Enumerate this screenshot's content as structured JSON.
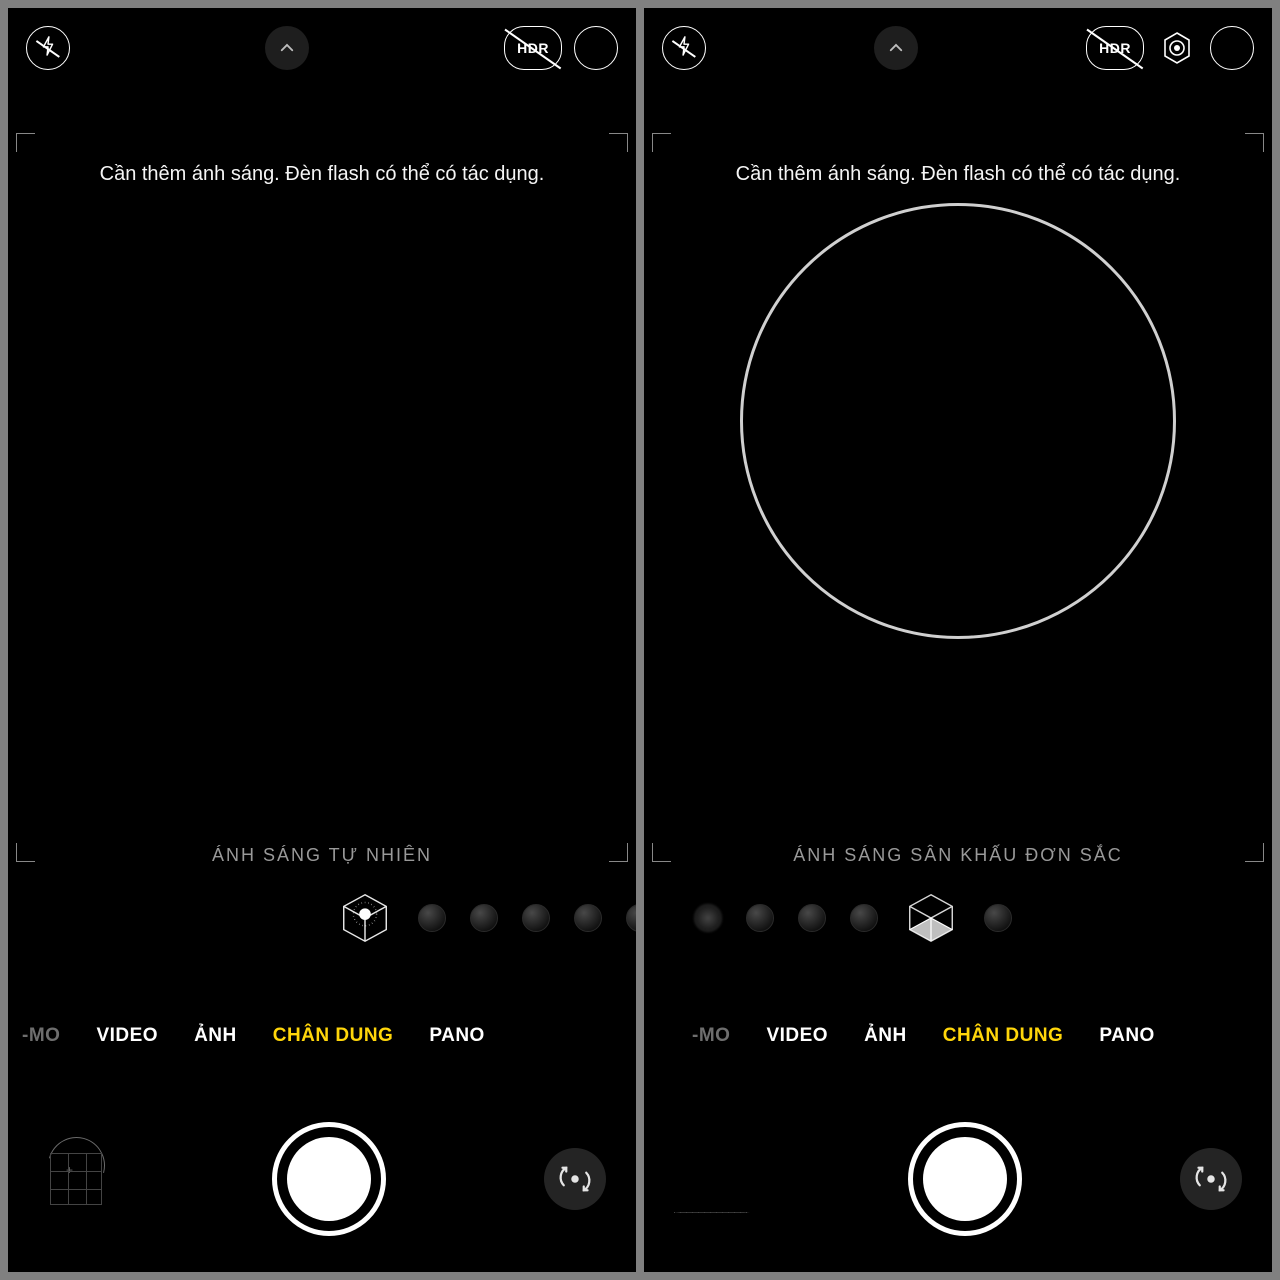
{
  "left": {
    "hint": "Cần thêm ánh sáng. Đèn flash có thể có tác dụng.",
    "lighting_label": "ÁNH SÁNG TỰ NHIÊN",
    "hdr_label": "HDR",
    "modes": {
      "cutoff": "-MO",
      "video": "VIDEO",
      "photo": "ẢNH",
      "portrait": "CHÂN DUNG",
      "pano": "PANO"
    }
  },
  "right": {
    "hint": "Cần thêm ánh sáng. Đèn flash có thể có tác dụng.",
    "lighting_label": "ÁNH SÁNG SÂN KHẤU ĐƠN SẮC",
    "hdr_label": "HDR",
    "modes": {
      "cutoff": "-MO",
      "video": "VIDEO",
      "photo": "ẢNH",
      "portrait": "CHÂN DUNG",
      "pano": "PANO"
    }
  }
}
